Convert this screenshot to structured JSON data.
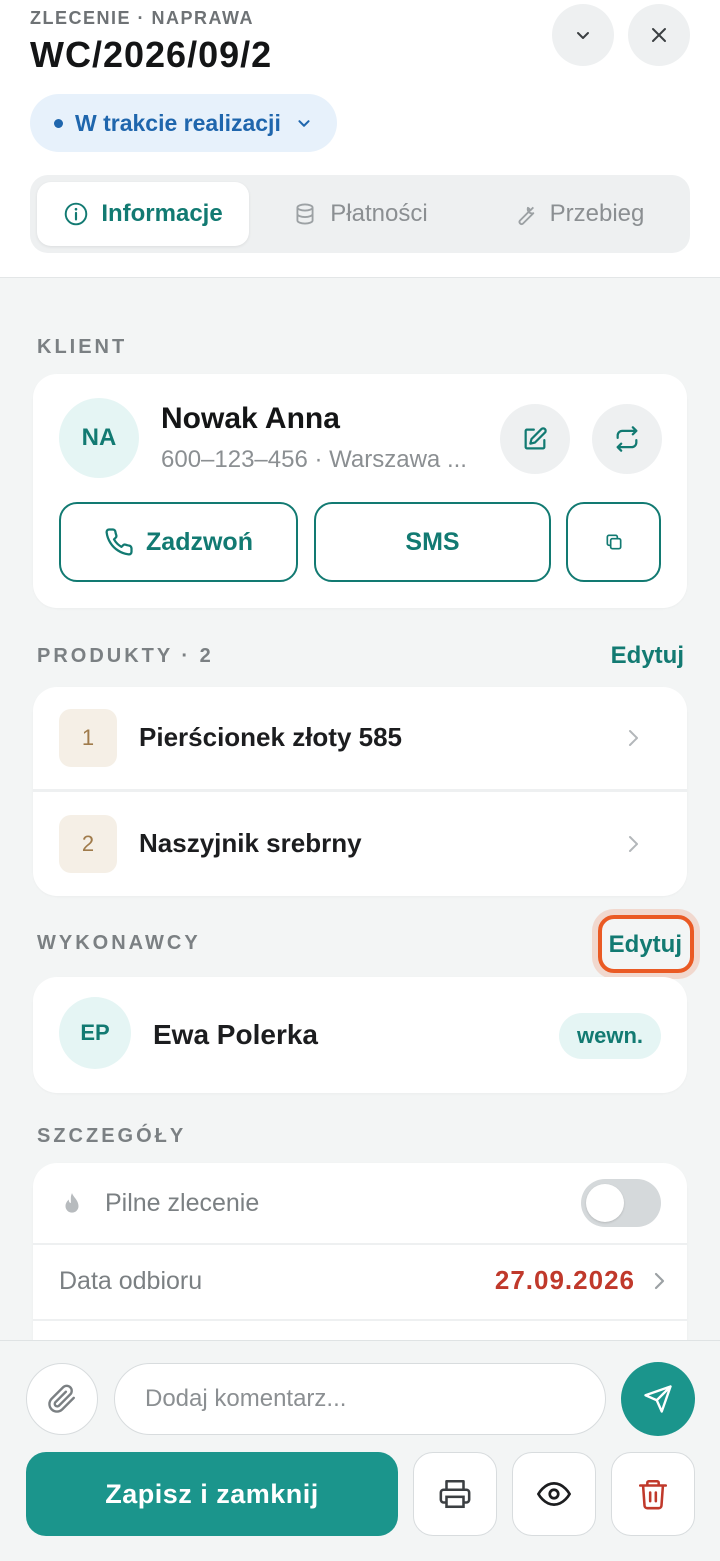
{
  "header": {
    "eyebrow": "ZLECENIE · NAPRAWA",
    "order_number": "WC/2026/09/2",
    "status": "W trakcie realizacji",
    "collapse_icon": "chevron-down-icon",
    "close_icon": "close-icon"
  },
  "tabs": [
    {
      "label": "Informacje",
      "icon": "info-icon",
      "active": true
    },
    {
      "label": "Płatności",
      "icon": "database-icon",
      "active": false
    },
    {
      "label": "Przebieg",
      "icon": "wrench-icon",
      "active": false
    }
  ],
  "client": {
    "section_label": "KLIENT",
    "initials": "NA",
    "name": "Nowak Anna",
    "subtitle": "600–123–456 · Warszawa ...",
    "call_label": "Zadzwoń",
    "sms_label": "SMS"
  },
  "products": {
    "section_label": "PRODUKTY · 2",
    "edit_label": "Edytuj",
    "items": [
      {
        "num": "1",
        "name": "Pierścionek złoty 585"
      },
      {
        "num": "2",
        "name": "Naszyjnik srebrny"
      }
    ]
  },
  "executors": {
    "section_label": "WYKONAWCY",
    "edit_label": "Edytuj",
    "items": [
      {
        "initials": "EP",
        "name": "Ewa Polerka",
        "tag": "wewn."
      }
    ]
  },
  "details": {
    "section_label": "SZCZEGÓŁY",
    "urgent_label": "Pilne zlecenie",
    "urgent_on": false,
    "pickup_label": "Data odbioru",
    "pickup_date": "27.09.2026"
  },
  "bottom": {
    "comment_placeholder": "Dodaj komentarz...",
    "save_label": "Zapisz i zamknij"
  },
  "colors": {
    "accent": "#127a72",
    "accent_fill": "#1b958c",
    "status_blue": "#1f66ad",
    "date_red": "#c0392b",
    "highlight": "#ea5a24"
  }
}
